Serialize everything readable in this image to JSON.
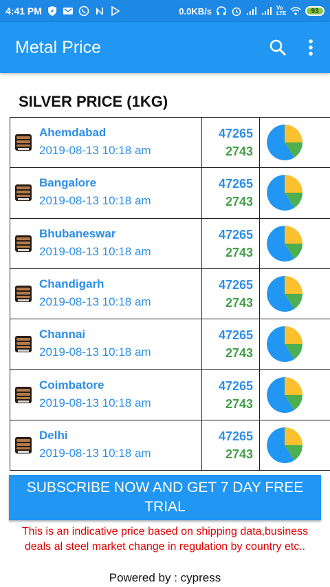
{
  "status_bar": {
    "time": "4:41 PM",
    "speed": "0.0KB/s",
    "battery": "93",
    "network_label": "Vo LTE"
  },
  "app_bar": {
    "title": "Metal Price",
    "search_icon": "search-icon",
    "menu_icon": "more-vert-icon"
  },
  "section": {
    "title": "SILVER PRICE (1KG)"
  },
  "rows": [
    {
      "city": "Ahemdabad",
      "date": "2019-08-13 10:18 am",
      "price": "47265",
      "change": "2743"
    },
    {
      "city": "Bangalore",
      "date": "2019-08-13 10:18 am",
      "price": "47265",
      "change": "2743"
    },
    {
      "city": "Bhubaneswar",
      "date": "2019-08-13 10:18 am",
      "price": "47265",
      "change": "2743"
    },
    {
      "city": "Chandigarh",
      "date": "2019-08-13 10:18 am",
      "price": "47265",
      "change": "2743"
    },
    {
      "city": "Channai",
      "date": "2019-08-13 10:18 am",
      "price": "47265",
      "change": "2743"
    },
    {
      "city": "Coimbatore",
      "date": "2019-08-13 10:18 am",
      "price": "47265",
      "change": "2743"
    },
    {
      "city": "Delhi",
      "date": "2019-08-13 10:18 am",
      "price": "47265",
      "change": "2743"
    }
  ],
  "colors": {
    "primary": "#2196f3",
    "status": "#1e88e5",
    "pie_blue": "#2196f3",
    "pie_yellow": "#fbc02d",
    "pie_green": "#4caf50",
    "price_green": "#43a047",
    "disclaimer_red": "#e00000"
  },
  "subscribe": {
    "label": "SUBSCRIBE NOW AND GET 7 DAY FREE TRIAL"
  },
  "disclaimer": "This is an indicative price based on shipping data,business deals al steel market change in regulation by country etc..",
  "powered_by": "Powered by : cypress"
}
